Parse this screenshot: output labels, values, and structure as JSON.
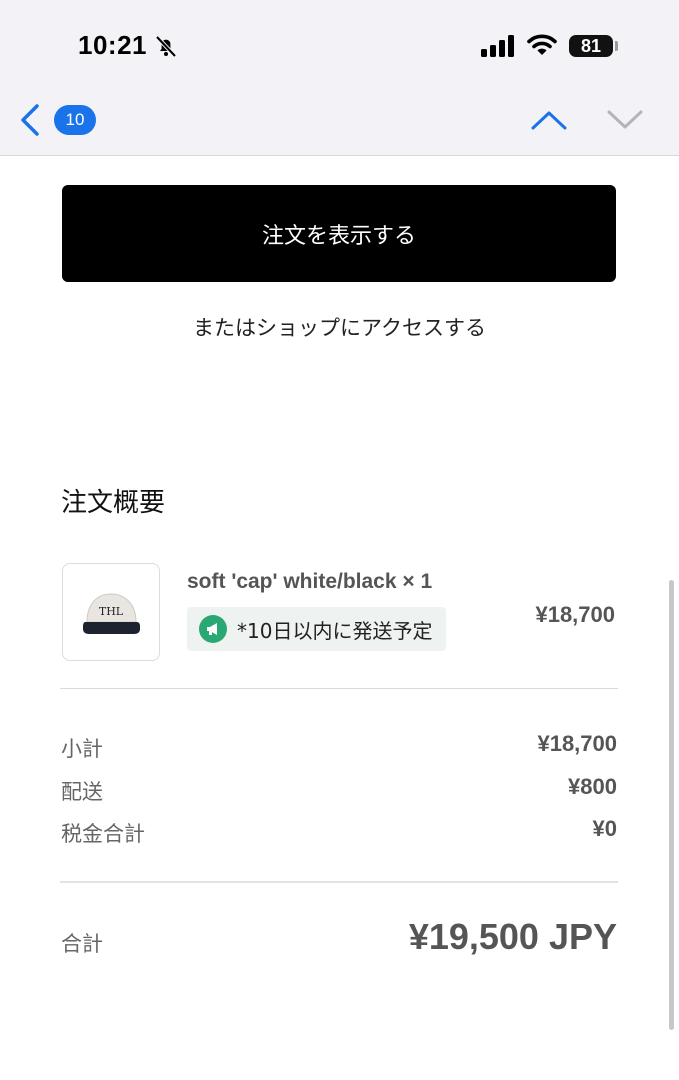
{
  "status_bar": {
    "time": "10:21",
    "battery": "81"
  },
  "mail_nav": {
    "unread_count": "10"
  },
  "order": {
    "view_order_label": "注文を表示する",
    "shop_link_label": "またはショップにアクセスする"
  },
  "summary": {
    "title": "注文概要",
    "item": {
      "name": "soft 'cap' white/black × 1",
      "shipping_note": "*10日以内に発送予定",
      "price": "¥18,700",
      "thumbnail_text": "THL"
    },
    "rows": [
      {
        "label": "小計",
        "value": "¥18,700"
      },
      {
        "label": "配送",
        "value": "¥800"
      },
      {
        "label": "税金合計",
        "value": "¥0"
      }
    ],
    "total_label": "合計",
    "total_value": "¥19,500 JPY"
  },
  "colors": {
    "accent": "#1a73e8",
    "button": "#000000",
    "ship_icon": "#2aa873"
  },
  "icons": [
    "bell-slash-icon",
    "signal-icon",
    "wifi-icon",
    "battery-icon",
    "chevron-left-icon",
    "chevron-up-icon",
    "chevron-down-icon",
    "megaphone-icon"
  ]
}
